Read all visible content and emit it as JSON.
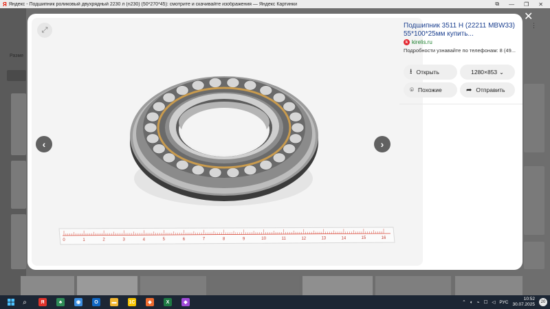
{
  "window": {
    "logo": "Я",
    "title": "Яндекс - Подшипник роликовый двухрядный 2230 л (n230) (50*270*45): смотрите и скачивайте изображения — Яндекс Картинки",
    "extensions_icon": "puzzle-icon",
    "minimize": "—",
    "restore": "❐",
    "close": "✕"
  },
  "background": {
    "sizes_label": "Разме"
  },
  "viewer": {
    "image_alt": "spherical roller bearing with ruler",
    "ruler_numbers": [
      "0",
      "1",
      "2",
      "3",
      "4",
      "5",
      "6",
      "7",
      "8",
      "9",
      "10",
      "11",
      "12",
      "13",
      "14",
      "15",
      "16"
    ],
    "prev_icon": "‹",
    "next_icon": "›"
  },
  "side": {
    "title": "Подшипник 3511 Н (22211 MBW33) 55*100*25мм купить...",
    "source_logo": "k",
    "source": "kirelis.ru",
    "description": "Подробности узнавайте по телефонам: 8 (49...",
    "open_label": "Открыть",
    "size_label": "1280×853",
    "similar_label": "Похожие",
    "share_label": "Отправить"
  },
  "close_icon": "✕",
  "taskbar": {
    "apps": [
      {
        "name": "yandex",
        "label": "Я",
        "color": "#e0332b"
      },
      {
        "name": "tiny-app",
        "label": "♣",
        "color": "#2e8b57"
      },
      {
        "name": "chrome",
        "label": "◉",
        "color": "#3b8de0"
      },
      {
        "name": "outlook",
        "label": "O",
        "color": "#1268c4"
      },
      {
        "name": "explorer",
        "label": "▬",
        "color": "#f2b632"
      },
      {
        "name": "1c",
        "label": "1С",
        "color": "#f6c400"
      },
      {
        "name": "app-orange",
        "label": "◆",
        "color": "#ef6c2f"
      },
      {
        "name": "excel",
        "label": "X",
        "color": "#1e7a44"
      },
      {
        "name": "app-gradient",
        "label": "◆",
        "color": "#a04ad8"
      }
    ],
    "tray_lang": "РУС",
    "time": "10:52",
    "date": "30.07.2025",
    "notifications": "20"
  }
}
